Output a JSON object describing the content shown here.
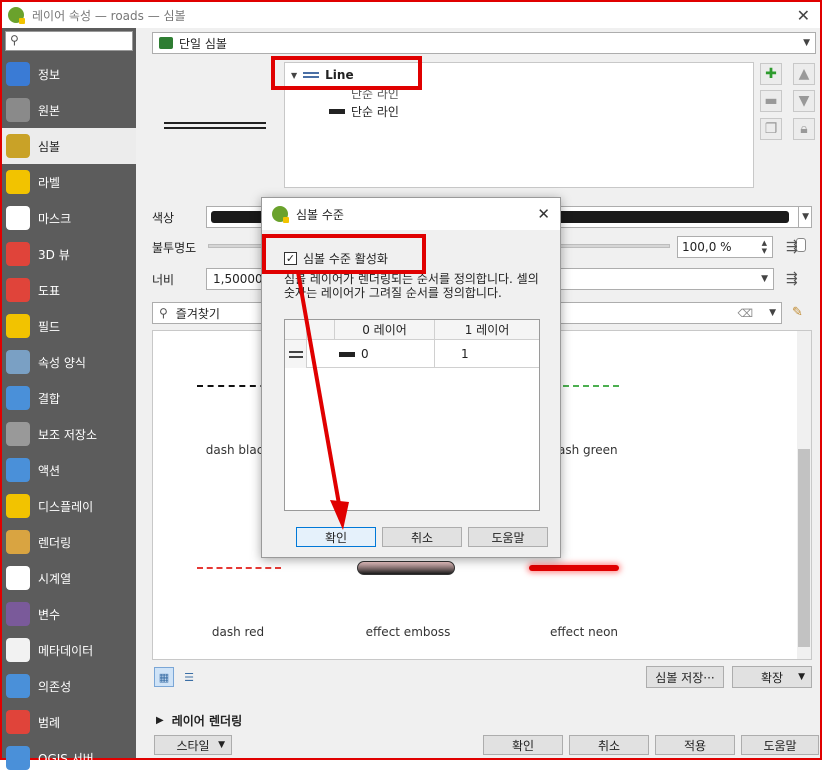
{
  "window": {
    "title": "레이어 속성 — roads — 심볼",
    "close_glyph": "✕"
  },
  "sidebar": {
    "search_placeholder": "",
    "items": [
      {
        "label": "정보",
        "icon": "info-icon",
        "color": "#3a7bd5"
      },
      {
        "label": "원본",
        "icon": "wrench-icon",
        "color": "#8a8a8a"
      },
      {
        "label": "심볼",
        "icon": "paintbrush-icon",
        "color": "#c9a227"
      },
      {
        "label": "라벨",
        "icon": "abc-label-icon",
        "color": "#f2c300"
      },
      {
        "label": "마스크",
        "icon": "abc-mask-icon",
        "color": "#ffffff"
      },
      {
        "label": "3D 뷰",
        "icon": "cube-icon",
        "color": "#e0443a"
      },
      {
        "label": "도표",
        "icon": "chart-icon",
        "color": "#e0443a"
      },
      {
        "label": "필드",
        "icon": "fields-icon",
        "color": "#f2c300"
      },
      {
        "label": "속성 양식",
        "icon": "form-icon",
        "color": "#7aa0c4"
      },
      {
        "label": "결합",
        "icon": "join-icon",
        "color": "#4a90d9"
      },
      {
        "label": "보조 저장소",
        "icon": "storage-icon",
        "color": "#999999"
      },
      {
        "label": "액션",
        "icon": "gear-icon",
        "color": "#4a90d9"
      },
      {
        "label": "디스플레이",
        "icon": "speech-bubble-icon",
        "color": "#f2c300"
      },
      {
        "label": "렌더링",
        "icon": "brush-icon",
        "color": "#d9a441"
      },
      {
        "label": "시계열",
        "icon": "clock-icon",
        "color": "#ffffff"
      },
      {
        "label": "변수",
        "icon": "variable-icon",
        "color": "#7a5a9a"
      },
      {
        "label": "메타데이터",
        "icon": "metadata-icon",
        "color": "#f2f2f2"
      },
      {
        "label": "의존성",
        "icon": "dependency-icon",
        "color": "#4a90d9"
      },
      {
        "label": "범례",
        "icon": "legend-icon",
        "color": "#e0443a"
      },
      {
        "label": "QGIS 서버",
        "icon": "server-icon",
        "color": "#4a90d9"
      }
    ]
  },
  "symbol": {
    "renderer": "단일 심볼",
    "tree_root": "Line",
    "tree_child_1": "단순 라인",
    "tree_child_2": "단순 라인"
  },
  "props": {
    "color_label": "색상",
    "opacity_label": "불투명도",
    "opacity_value": "100,0 %",
    "opacity_fraction": 1.0,
    "width_label": "너비",
    "width_value": "1,50000",
    "favorites_placeholder": "즐겨찾기"
  },
  "gallery": {
    "row1": [
      {
        "label": "dash  black"
      },
      {
        "label": ""
      },
      {
        "label": "dash green"
      }
    ],
    "row2": [
      {
        "label": "dash red"
      },
      {
        "label": "effect emboss"
      },
      {
        "label": "effect neon"
      }
    ]
  },
  "bottom": {
    "save_symbol": "심볼 저장···",
    "advanced": "확장",
    "layer_rendering": "레이어 렌더링",
    "style": "스타일",
    "ok": "확인",
    "cancel": "취소",
    "apply": "적용",
    "help": "도움말"
  },
  "dialog": {
    "title": "심볼 수준",
    "enable_label": "심볼 수준 활성화",
    "enabled": true,
    "description": "심볼 레이어가 렌더링되는 순서를 정의합니다. 셀의 숫자는 레이어가 그려질 순서를 정의합니다.",
    "col_0": "0 레이어",
    "col_1": "1 레이어",
    "row_value_0": "0",
    "row_value_1": "1",
    "ok": "확인",
    "cancel": "취소",
    "help": "도움말"
  },
  "colors": {
    "highlight_red": "#e00000",
    "dash_green": "#4caf50",
    "dash_red": "#e53935",
    "neon_red": "#e00000"
  }
}
